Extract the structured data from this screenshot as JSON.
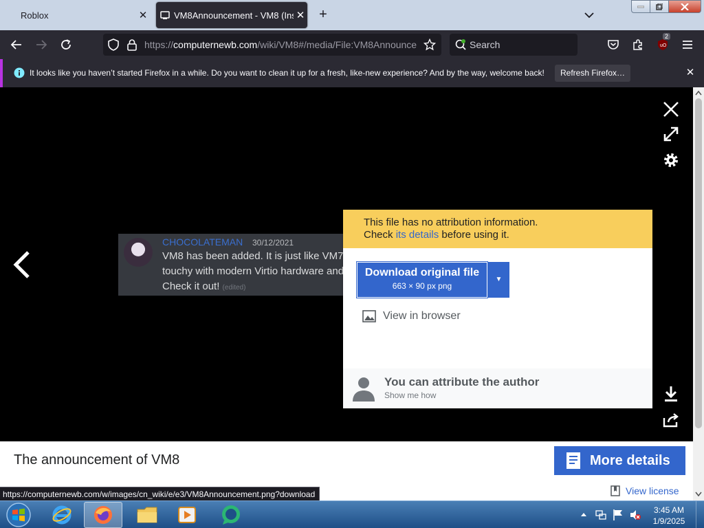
{
  "browser": {
    "tabs": [
      {
        "label": "Roblox",
        "active": false
      },
      {
        "label": "VM8Announcement - VM8 (Ins",
        "active": true
      }
    ],
    "new_tab_symbol": "+",
    "url": {
      "prefix": "https://",
      "host": "computernewb.com",
      "path": "/wiki/VM8#/media/File:VM8Announce"
    },
    "search_placeholder": "Search",
    "extension_badge": "2",
    "notification": {
      "text": "It looks like you haven’t started Firefox in a while. Do you want to clean it up for a fresh, like-new experience? And by the way, welcome back!",
      "button_label": "Refresh Firefox…"
    },
    "status_url": "https://computernewb.com/w/images/cn_wiki/e/e3/VM8Announcement.png?download"
  },
  "viewer": {
    "message": {
      "username": "CHOCOLATEMAN",
      "date": "30/12/2021",
      "line1": "VM8 has been added. It is just like VM7",
      "line2": "touchy with modern Virtio hardware and",
      "line3": "Check it out!",
      "edited": "(edited)"
    },
    "popup": {
      "warning_line1": "This file has no attribution information.",
      "warning_pre": "Check ",
      "warning_link": "its details",
      "warning_post": " before using it.",
      "download_label": "Download original file",
      "download_sub": "663 × 90 px png",
      "view_in_browser": "View in browser",
      "attribute_title": "You can attribute the author",
      "attribute_sub": "Show me how"
    },
    "caption": "The announcement of VM8",
    "more_details_label": "More details",
    "view_license_label": "View license"
  },
  "taskbar": {
    "items": [
      "start-orb",
      "internet-explorer",
      "firefox",
      "file-explorer",
      "media-player",
      "chat-app"
    ],
    "clock_time": "3:45 AM",
    "clock_date": "1/9/2025"
  },
  "colors": {
    "accent_blue": "#3366cc",
    "warning_yellow": "#f8ce5c",
    "browser_dark": "#2b2a33",
    "tabstrip": "#c9d5e5"
  }
}
